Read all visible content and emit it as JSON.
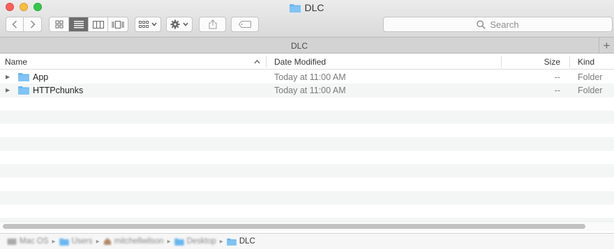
{
  "window": {
    "title": "DLC"
  },
  "toolbar": {
    "back_icon": "chevron-left-icon",
    "forward_icon": "chevron-right-icon",
    "view_modes": [
      "icon-view-icon",
      "list-view-icon",
      "column-view-icon",
      "cover-flow-icon"
    ],
    "active_view": "list-view-icon",
    "arrange_icon": "arrange-grid-icon",
    "action_icon": "gear-icon",
    "share_icon": "share-icon",
    "tags_icon": "tag-icon"
  },
  "search": {
    "placeholder": "Search"
  },
  "tabbar": {
    "tab_label": "DLC",
    "new_tab_label": "+"
  },
  "columns": {
    "name": "Name",
    "date_modified": "Date Modified",
    "size": "Size",
    "kind": "Kind"
  },
  "files": [
    {
      "name": "App",
      "date": "Today at 11:00 AM",
      "size": "--",
      "kind": "Folder"
    },
    {
      "name": "HTTPchunks",
      "date": "Today at 11:00 AM",
      "size": "--",
      "kind": "Folder"
    }
  ],
  "pathbar": {
    "items": [
      {
        "label": "Mac OS",
        "icon": "hard-drive-icon"
      },
      {
        "label": "Users",
        "icon": "folder-icon"
      },
      {
        "label": "mitchellwilson",
        "icon": "home-icon"
      },
      {
        "label": "Desktop",
        "icon": "folder-icon"
      },
      {
        "label": "DLC",
        "icon": "folder-icon"
      }
    ]
  },
  "colors": {
    "folder": "#68b7f0",
    "accent": "#6d6d6d"
  }
}
